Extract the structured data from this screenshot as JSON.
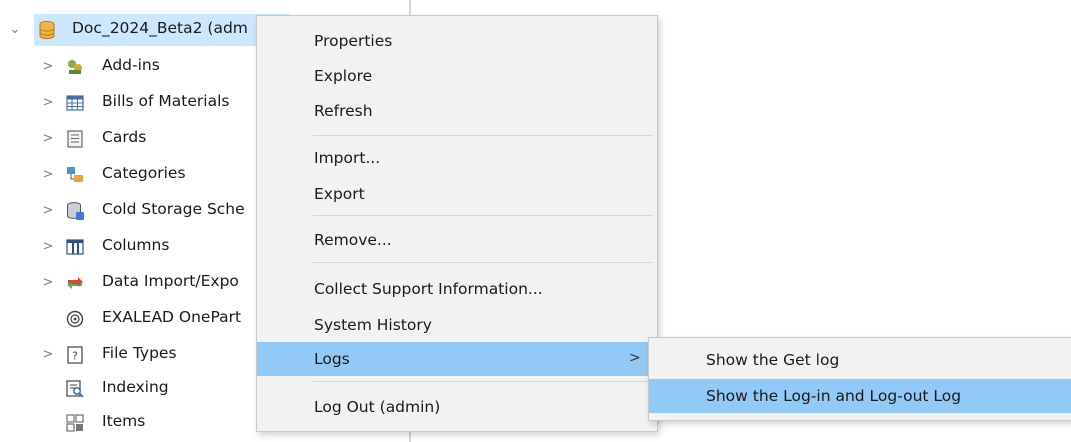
{
  "tree": {
    "root": {
      "label": "Doc_2024_Beta2 (adm",
      "icon": "database-icon",
      "expanded": true
    },
    "items": [
      {
        "label": "Add-ins",
        "icon": "addins-icon",
        "has_children": true
      },
      {
        "label": "Bills of Materials",
        "icon": "table-icon",
        "has_children": true
      },
      {
        "label": "Cards",
        "icon": "card-icon",
        "has_children": true
      },
      {
        "label": "Categories",
        "icon": "categories-icon",
        "has_children": true
      },
      {
        "label": "Cold Storage Sche",
        "icon": "cold-storage-icon",
        "has_children": true
      },
      {
        "label": "Columns",
        "icon": "columns-icon",
        "has_children": true
      },
      {
        "label": "Data Import/Expo",
        "icon": "data-import-icon",
        "has_children": true
      },
      {
        "label": "EXALEAD OnePart",
        "icon": "exalead-icon",
        "has_children": false
      },
      {
        "label": "File Types",
        "icon": "file-types-icon",
        "has_children": true
      },
      {
        "label": "Indexing",
        "icon": "indexing-icon",
        "has_children": false
      },
      {
        "label": "Items",
        "icon": "items-icon",
        "has_children": false
      }
    ]
  },
  "context_menu": {
    "items": [
      {
        "label": "Properties"
      },
      {
        "label": "Explore"
      },
      {
        "label": "Refresh"
      },
      {
        "label": "Import..."
      },
      {
        "label": "Export"
      },
      {
        "label": "Remove..."
      },
      {
        "label": "Collect Support Information..."
      },
      {
        "label": "System History"
      },
      {
        "label": "Logs",
        "highlighted": true,
        "has_submenu": true
      },
      {
        "label": "Log Out (admin)"
      }
    ]
  },
  "submenu": {
    "items": [
      {
        "label": "Show the Get log"
      },
      {
        "label": "Show the Log-in and Log-out Log",
        "highlighted": true
      }
    ]
  },
  "colors": {
    "menu_bg": "#f2f2f2",
    "highlight": "#91c9f7",
    "selection": "#cce8ff"
  }
}
